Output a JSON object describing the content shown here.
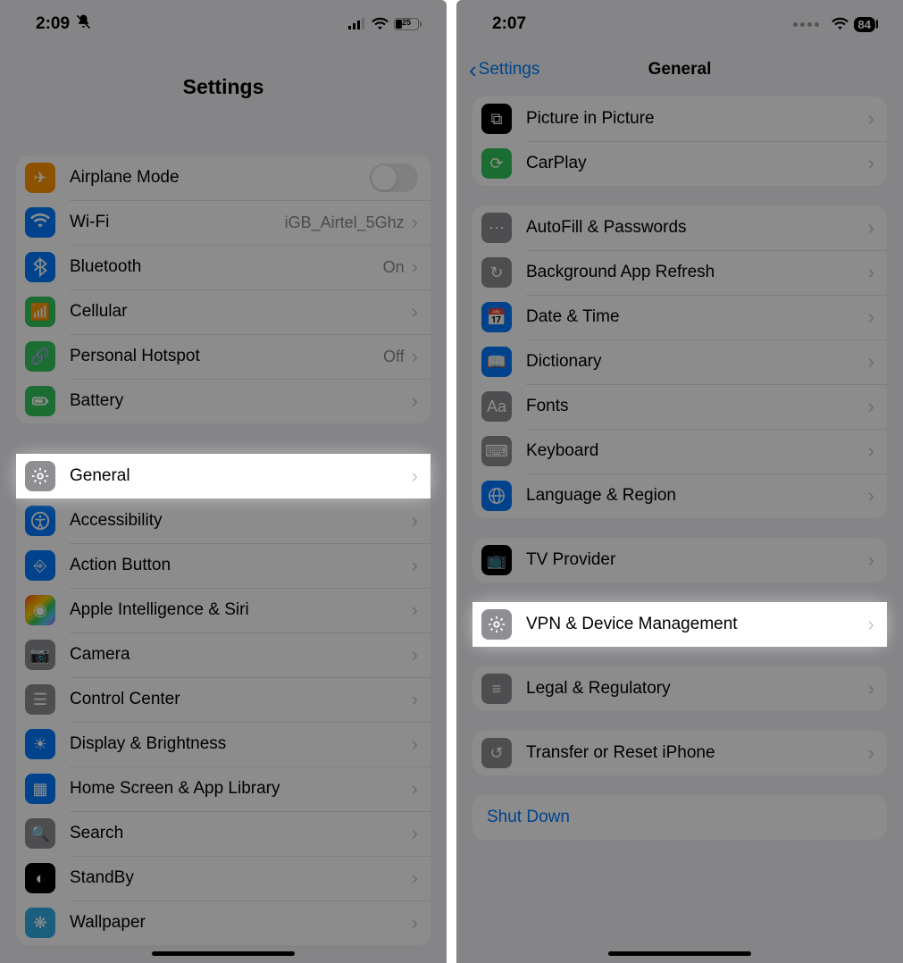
{
  "left": {
    "status": {
      "time": "2:09",
      "battery": "25"
    },
    "title": "Settings",
    "groups": [
      [
        {
          "key": "airplane",
          "label": "Airplane Mode",
          "icon": "airplane-icon",
          "color": "orange",
          "toggle": false
        },
        {
          "key": "wifi",
          "label": "Wi-Fi",
          "icon": "wifi-icon",
          "color": "blue",
          "value": "iGB_Airtel_5Ghz",
          "chevron": true
        },
        {
          "key": "bluetooth",
          "label": "Bluetooth",
          "icon": "bluetooth-icon",
          "color": "blue",
          "value": "On",
          "chevron": true
        },
        {
          "key": "cellular",
          "label": "Cellular",
          "icon": "antenna-icon",
          "color": "green",
          "chevron": true
        },
        {
          "key": "hotspot",
          "label": "Personal Hotspot",
          "icon": "link-icon",
          "color": "green",
          "value": "Off",
          "chevron": true
        },
        {
          "key": "battery",
          "label": "Battery",
          "icon": "battery-icon",
          "color": "green",
          "chevron": true
        }
      ],
      [
        {
          "key": "general",
          "label": "General",
          "icon": "gear-icon",
          "color": "gray",
          "chevron": true,
          "highlight": true
        },
        {
          "key": "accessibility",
          "label": "Accessibility",
          "icon": "accessibility-icon",
          "color": "blue",
          "chevron": true
        },
        {
          "key": "actionbutton",
          "label": "Action Button",
          "icon": "action-icon",
          "color": "blue",
          "chevron": true
        },
        {
          "key": "siri",
          "label": "Apple Intelligence & Siri",
          "icon": "siri-icon",
          "color": "rainbow",
          "chevron": true
        },
        {
          "key": "camera",
          "label": "Camera",
          "icon": "camera-icon",
          "color": "gray",
          "chevron": true
        },
        {
          "key": "controlcenter",
          "label": "Control Center",
          "icon": "switches-icon",
          "color": "gray",
          "chevron": true
        },
        {
          "key": "display",
          "label": "Display & Brightness",
          "icon": "sun-icon",
          "color": "blue",
          "chevron": true
        },
        {
          "key": "homescreen",
          "label": "Home Screen & App Library",
          "icon": "apps-icon",
          "color": "blue",
          "chevron": true
        },
        {
          "key": "search",
          "label": "Search",
          "icon": "search-icon",
          "color": "gray",
          "chevron": true
        },
        {
          "key": "standby",
          "label": "StandBy",
          "icon": "standby-icon",
          "color": "black",
          "chevron": true
        },
        {
          "key": "wallpaper",
          "label": "Wallpaper",
          "icon": "flower-icon",
          "color": "teal",
          "chevron": true
        }
      ]
    ]
  },
  "right": {
    "status": {
      "time": "2:07",
      "battery": "84"
    },
    "back": "Settings",
    "title": "General",
    "groups": [
      [
        {
          "key": "pip",
          "label": "Picture in Picture",
          "icon": "pip-icon",
          "color": "black",
          "chevron": true
        },
        {
          "key": "carplay",
          "label": "CarPlay",
          "icon": "carplay-icon",
          "color": "green",
          "chevron": true
        }
      ],
      [
        {
          "key": "autofill",
          "label": "AutoFill & Passwords",
          "icon": "password-icon",
          "color": "gray",
          "chevron": true
        },
        {
          "key": "bgrefresh",
          "label": "Background App Refresh",
          "icon": "refresh-icon",
          "color": "gray",
          "chevron": true
        },
        {
          "key": "datetime",
          "label": "Date & Time",
          "icon": "calendar-icon",
          "color": "blue",
          "chevron": true
        },
        {
          "key": "dictionary",
          "label": "Dictionary",
          "icon": "book-icon",
          "color": "blue",
          "chevron": true
        },
        {
          "key": "fonts",
          "label": "Fonts",
          "icon": "font-icon",
          "color": "gray",
          "chevron": true
        },
        {
          "key": "keyboard",
          "label": "Keyboard",
          "icon": "keyboard-icon",
          "color": "gray",
          "chevron": true
        },
        {
          "key": "language",
          "label": "Language & Region",
          "icon": "globe-icon",
          "color": "blue",
          "chevron": true
        }
      ],
      [
        {
          "key": "tvprovider",
          "label": "TV Provider",
          "icon": "tv-icon",
          "color": "black",
          "chevron": true
        }
      ],
      [
        {
          "key": "vpn",
          "label": "VPN & Device Management",
          "icon": "gear-icon",
          "color": "gray",
          "chevron": true,
          "highlight": true
        }
      ],
      [
        {
          "key": "legal",
          "label": "Legal & Regulatory",
          "icon": "doc-icon",
          "color": "gray",
          "chevron": true
        }
      ],
      [
        {
          "key": "reset",
          "label": "Transfer or Reset iPhone",
          "icon": "reset-icon",
          "color": "gray",
          "chevron": true
        }
      ],
      [
        {
          "key": "shutdown",
          "label": "Shut Down",
          "link": true
        }
      ]
    ]
  }
}
